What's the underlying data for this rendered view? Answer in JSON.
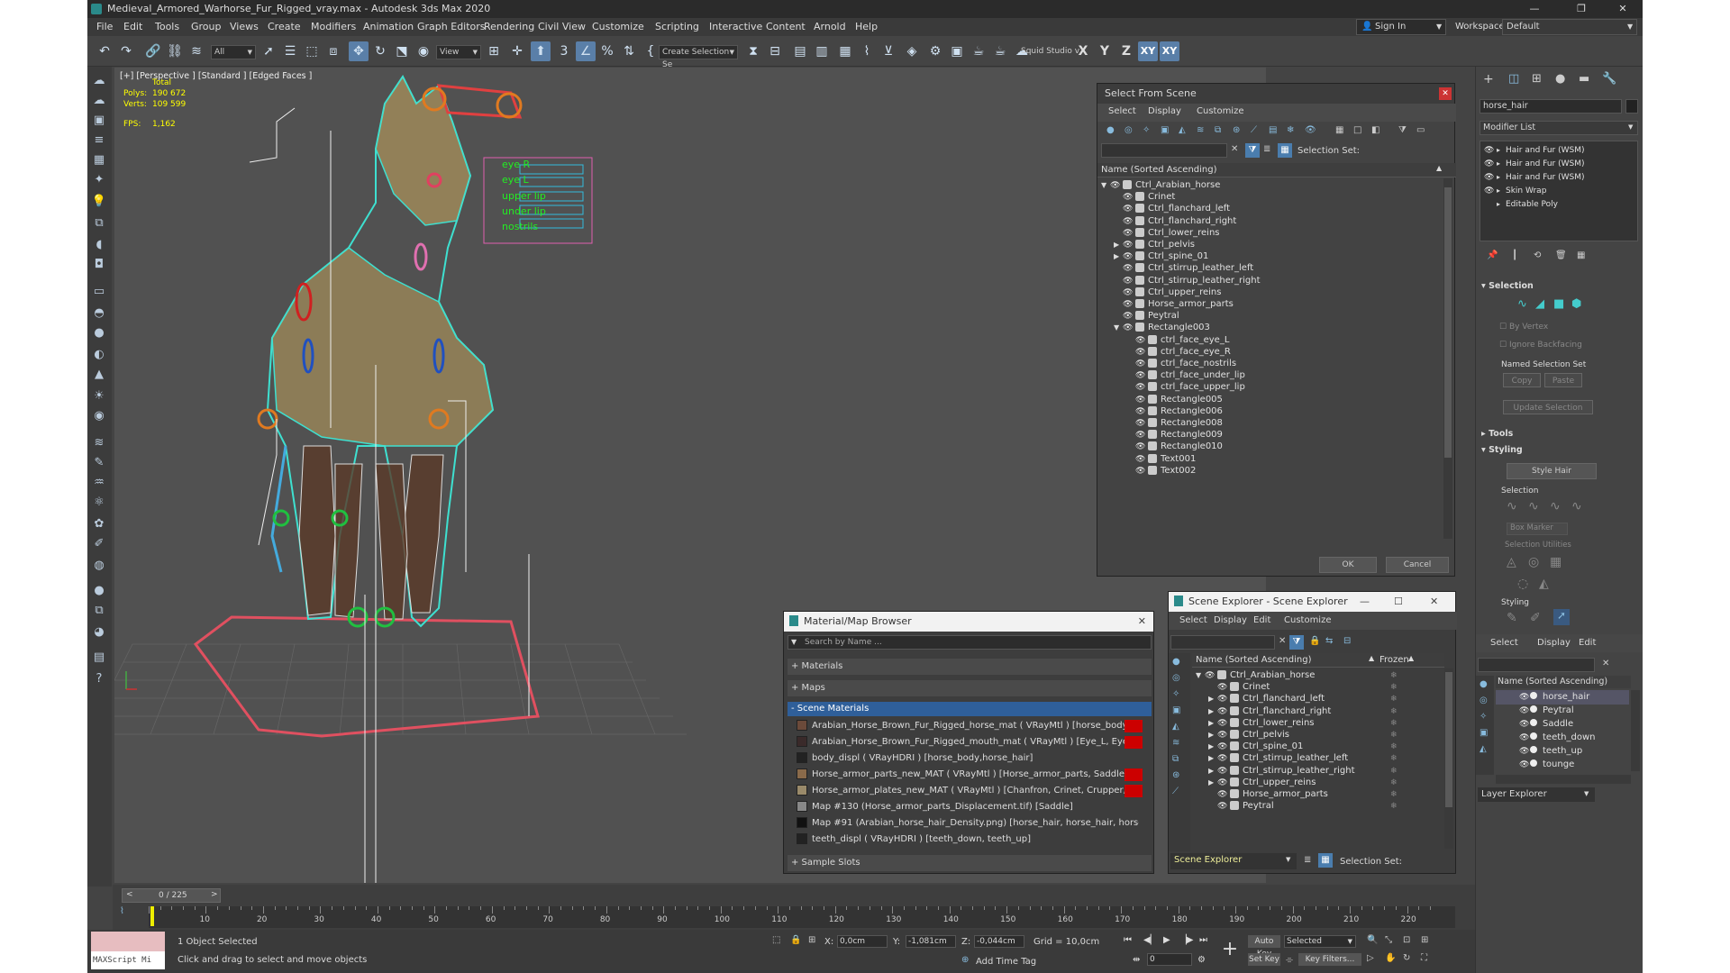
{
  "window": {
    "title": "Medieval_Armored_Warhorse_Fur_Rigged_vray.max - Autodesk 3ds Max 2020",
    "controls": [
      "—",
      "❐",
      "✕"
    ]
  },
  "menu": [
    "File",
    "Edit",
    "Tools",
    "Group",
    "Views",
    "Create",
    "Modifiers",
    "Animation",
    "Graph Editors",
    "Rendering",
    "Civil View",
    "Customize",
    "Scripting",
    "Interactive",
    "Content",
    "Arnold",
    "Help"
  ],
  "signin": {
    "label": "Sign In",
    "workspaces_label": "Workspaces:",
    "workspaces_value": "Default"
  },
  "toolbar": {
    "filter": "All",
    "view": "View",
    "create_selection": "Create Selection Se",
    "squid": "Squid Studio v",
    "axes": [
      "X",
      "Y",
      "Z",
      "XY",
      "XY"
    ]
  },
  "viewport": {
    "label": "[+] [Perspective ] [Standard ] [Edged Faces ]",
    "stats_total": "Total",
    "polys_label": "Polys:",
    "polys_value": "190 672",
    "verts_label": "Verts:",
    "verts_value": "109 599",
    "fps_label": "FPS:",
    "fps_value": "1,162",
    "rig_labels": [
      "eye R",
      "eye L",
      "upper lip",
      "under lip",
      "nostrils"
    ]
  },
  "select_from_scene": {
    "title": "Select From Scene",
    "tabs": [
      "Select",
      "Display",
      "Customize"
    ],
    "selection_set_label": "Selection Set:",
    "column": "Name (Sorted Ascending)",
    "rows": [
      {
        "label": "Ctrl_Arabian_horse",
        "depth": 0,
        "expand": "▼"
      },
      {
        "label": "Crinet",
        "depth": 1,
        "expand": ""
      },
      {
        "label": "Ctrl_flanchard_left",
        "depth": 1,
        "expand": ""
      },
      {
        "label": "Ctrl_flanchard_right",
        "depth": 1,
        "expand": ""
      },
      {
        "label": "Ctrl_lower_reins",
        "depth": 1,
        "expand": ""
      },
      {
        "label": "Ctrl_pelvis",
        "depth": 1,
        "expand": "▶"
      },
      {
        "label": "Ctrl_spine_01",
        "depth": 1,
        "expand": "▶"
      },
      {
        "label": "Ctrl_stirrup_leather_left",
        "depth": 1,
        "expand": ""
      },
      {
        "label": "Ctrl_stirrup_leather_right",
        "depth": 1,
        "expand": ""
      },
      {
        "label": "Ctrl_upper_reins",
        "depth": 1,
        "expand": ""
      },
      {
        "label": "Horse_armor_parts",
        "depth": 1,
        "expand": ""
      },
      {
        "label": "Peytral",
        "depth": 1,
        "expand": ""
      },
      {
        "label": "Rectangle003",
        "depth": 1,
        "expand": "▼"
      },
      {
        "label": "ctrl_face_eye_L",
        "depth": 2,
        "expand": ""
      },
      {
        "label": "ctrl_face_eye_R",
        "depth": 2,
        "expand": ""
      },
      {
        "label": "ctrl_face_nostrils",
        "depth": 2,
        "expand": ""
      },
      {
        "label": "ctrl_face_under_lip",
        "depth": 2,
        "expand": ""
      },
      {
        "label": "ctrl_face_upper_lip",
        "depth": 2,
        "expand": ""
      },
      {
        "label": "Rectangle005",
        "depth": 2,
        "expand": ""
      },
      {
        "label": "Rectangle006",
        "depth": 2,
        "expand": ""
      },
      {
        "label": "Rectangle008",
        "depth": 2,
        "expand": ""
      },
      {
        "label": "Rectangle009",
        "depth": 2,
        "expand": ""
      },
      {
        "label": "Rectangle010",
        "depth": 2,
        "expand": ""
      },
      {
        "label": "Text001",
        "depth": 2,
        "expand": ""
      },
      {
        "label": "Text002",
        "depth": 2,
        "expand": ""
      }
    ],
    "ok": "OK",
    "cancel": "Cancel"
  },
  "material_browser": {
    "title": "Material/Map Browser",
    "search_placeholder": "Search by Name ...",
    "sections": [
      "+ Materials",
      "+ Maps",
      "- Scene Materials",
      "+ Sample Slots"
    ],
    "items": [
      {
        "label": "Arabian_Horse_Brown_Fur_Rigged_horse_mat ( VRayMtl ) [horse_body, hor...",
        "swatch": "#6b4a3a",
        "flag": true
      },
      {
        "label": "Arabian_Horse_Brown_Fur_Rigged_mouth_mat ( VRayMtl ) [Eye_L, Eye_R, t...",
        "swatch": "#3a2a2a",
        "flag": true
      },
      {
        "label": "body_displ ( VRayHDRI ) [horse_body,horse_hair]",
        "swatch": "#222",
        "flag": false
      },
      {
        "label": "Horse_armor_parts_new_MAT ( VRayMtl ) [Horse_armor_parts, Saddle]",
        "swatch": "#8a6a4a",
        "flag": true
      },
      {
        "label": "Horse_armor_plates_new_MAT ( VRayMtl ) [Chanfron, Crinet, Crupper, Flan...",
        "swatch": "#9a8a6a",
        "flag": true
      },
      {
        "label": "Map #130 (Horse_armor_parts_Displacement.tif) [Saddle]",
        "swatch": "#888",
        "flag": false
      },
      {
        "label": "Map #91 (Arabian_horse_hair_Density.png) [horse_hair, horse_hair, horse_h...",
        "swatch": "#111",
        "flag": false
      },
      {
        "label": "teeth_displ ( VRayHDRI ) [teeth_down, teeth_up]",
        "swatch": "#222",
        "flag": false
      }
    ]
  },
  "scene_explorer": {
    "title": "Scene Explorer - Scene Explorer",
    "tabs": [
      "Select",
      "Display",
      "Edit",
      "Customize"
    ],
    "column": "Name (Sorted Ascending)",
    "column2": "Frozen",
    "rows": [
      {
        "label": "Ctrl_Arabian_horse",
        "depth": 0,
        "expand": "▼"
      },
      {
        "label": "Crinet",
        "depth": 1,
        "expand": ""
      },
      {
        "label": "Ctrl_flanchard_left",
        "depth": 1,
        "expand": "▶"
      },
      {
        "label": "Ctrl_flanchard_right",
        "depth": 1,
        "expand": "▶"
      },
      {
        "label": "Ctrl_lower_reins",
        "depth": 1,
        "expand": "▶"
      },
      {
        "label": "Ctrl_pelvis",
        "depth": 1,
        "expand": "▶"
      },
      {
        "label": "Ctrl_spine_01",
        "depth": 1,
        "expand": "▶"
      },
      {
        "label": "Ctrl_stirrup_leather_left",
        "depth": 1,
        "expand": "▶"
      },
      {
        "label": "Ctrl_stirrup_leather_right",
        "depth": 1,
        "expand": "▶"
      },
      {
        "label": "Ctrl_upper_reins",
        "depth": 1,
        "expand": "▶"
      },
      {
        "label": "Horse_armor_parts",
        "depth": 1,
        "expand": ""
      },
      {
        "label": "Peytral",
        "depth": 1,
        "expand": ""
      }
    ],
    "footer_name": "Scene Explorer",
    "selection_set_label": "Selection Set:"
  },
  "right_panel": {
    "object_name": "horse_hair",
    "modifier_list": "Modifier List",
    "stack": [
      "Hair and Fur (WSM)",
      "Hair and Fur (WSM)",
      "Hair and Fur (WSM)",
      "Skin Wrap",
      "Editable Poly"
    ],
    "selection_title": "Selection",
    "by_vertex": "By Vertex",
    "ignore_backfacing": "Ignore Backfacing",
    "named_selection_set": "Named Selection Set",
    "copy": "Copy",
    "paste": "Paste",
    "update_selection": "Update Selection",
    "tools_title": "Tools",
    "styling_title": "Styling",
    "style_hair": "Style Hair",
    "selection_sub": "Selection",
    "box_marker": "Box Marker",
    "selection_utilities": "Selection Utilities",
    "styling_sub": "Styling"
  },
  "layer_panel": {
    "tabs": [
      "Select",
      "Display",
      "Edit"
    ],
    "column": "Name (Sorted Ascending)",
    "rows": [
      "horse_hair",
      "Peytral",
      "Saddle",
      "teeth_down",
      "teeth_up",
      "tounge"
    ],
    "footer": "Layer Explorer"
  },
  "timeline": {
    "frame": "0 / 225",
    "ticks": [
      "10",
      "20",
      "30",
      "40",
      "50",
      "60",
      "70",
      "80",
      "90",
      "100",
      "110",
      "120",
      "130",
      "140",
      "150",
      "160",
      "170",
      "180",
      "190",
      "200",
      "210",
      "220"
    ]
  },
  "status": {
    "maxscript": "MAXScript Mi",
    "selected": "1 Object Selected",
    "hint": "Click and drag to select and move objects",
    "x_label": "X:",
    "x_value": "0,0cm",
    "y_label": "Y:",
    "y_value": "-1,081cm",
    "z_label": "Z:",
    "z_value": "-0,044cm",
    "grid": "Grid = 10,0cm",
    "add_time_tag": "Add Time Tag",
    "auto_key": "Auto Key",
    "set_key": "Set Key",
    "selected_dd": "Selected",
    "key_filters": "Key Filters...",
    "frame_field": "0"
  }
}
